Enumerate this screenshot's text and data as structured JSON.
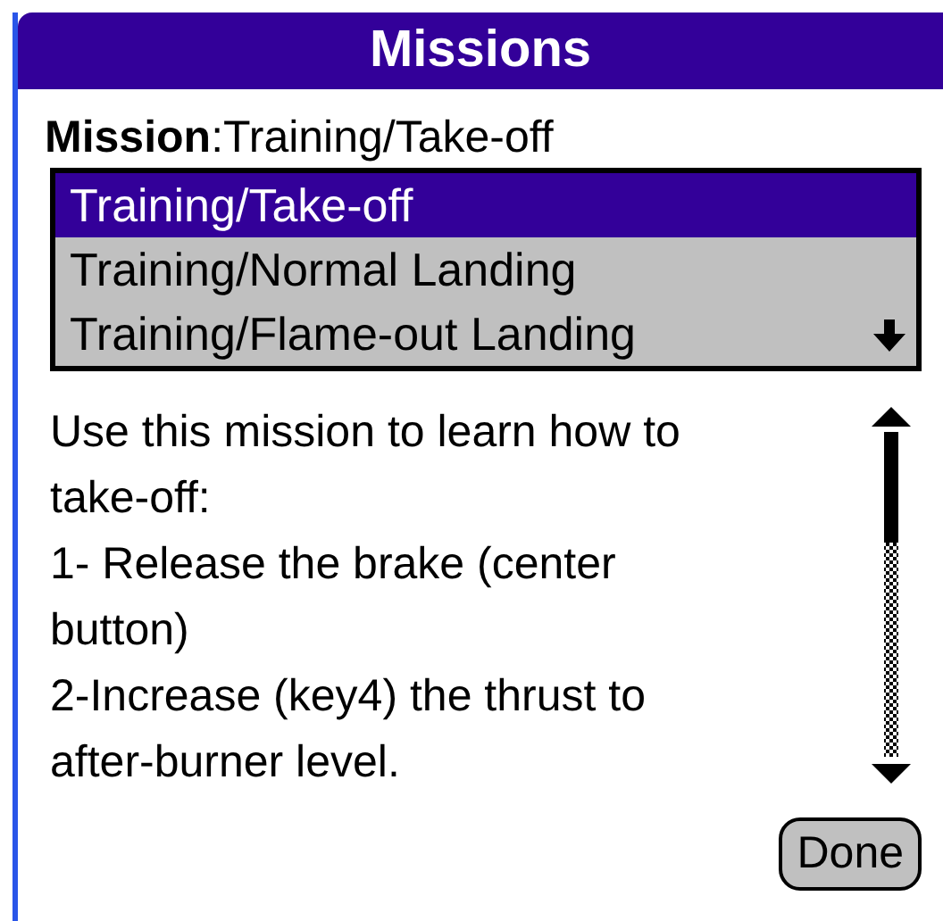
{
  "window": {
    "title": "Missions"
  },
  "mission_label": "**Mission**:Training/Take-off",
  "missions": [
    {
      "label": "Training/Take-off",
      "selected": true
    },
    {
      "label": "Training/Normal Landing",
      "selected": false
    },
    {
      "label": "Training/Flame-out Landing",
      "selected": false
    }
  ],
  "description": "Use this mission to learn how to\ntake-off:\n1- Release the brake (center\nbutton)\n2-Increase (key4) the thrust to\nafter-burner level.",
  "buttons": [
    "Done"
  ]
}
